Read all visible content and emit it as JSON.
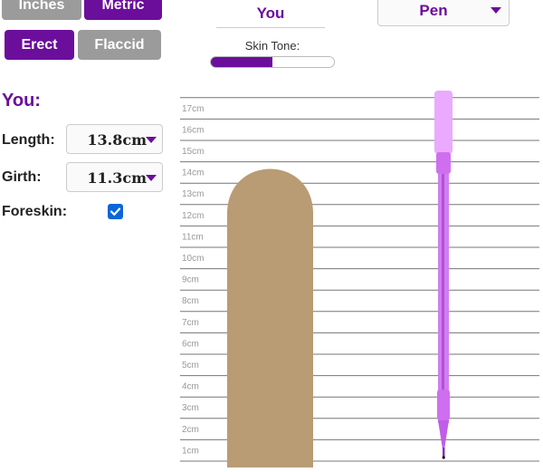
{
  "units": {
    "inches_label": "Inches",
    "metric_label": "Metric",
    "selected": "Metric"
  },
  "state": {
    "erect_label": "Erect",
    "flaccid_label": "Flaccid",
    "selected": "Erect"
  },
  "compare": {
    "you_label": "You",
    "object_label": "Pen"
  },
  "skin_tone": {
    "label": "Skin Tone:",
    "level": 0.5
  },
  "you": {
    "heading": "You:",
    "length_label": "Length:",
    "length_value": "13.8cm",
    "girth_label": "Girth:",
    "girth_value": "11.3cm",
    "foreskin_label": "Foreskin:",
    "foreskin_checked": true
  },
  "ruler": {
    "ticks": [
      "1cm",
      "2cm",
      "3cm",
      "4cm",
      "5cm",
      "6cm",
      "7cm",
      "8cm",
      "9cm",
      "10cm",
      "11cm",
      "12cm",
      "13cm",
      "14cm",
      "15cm",
      "16cm",
      "17cm"
    ]
  },
  "colors": {
    "accent": "#6b0e9c",
    "skin": "#b99b74",
    "pen": "#cf6ff0"
  }
}
